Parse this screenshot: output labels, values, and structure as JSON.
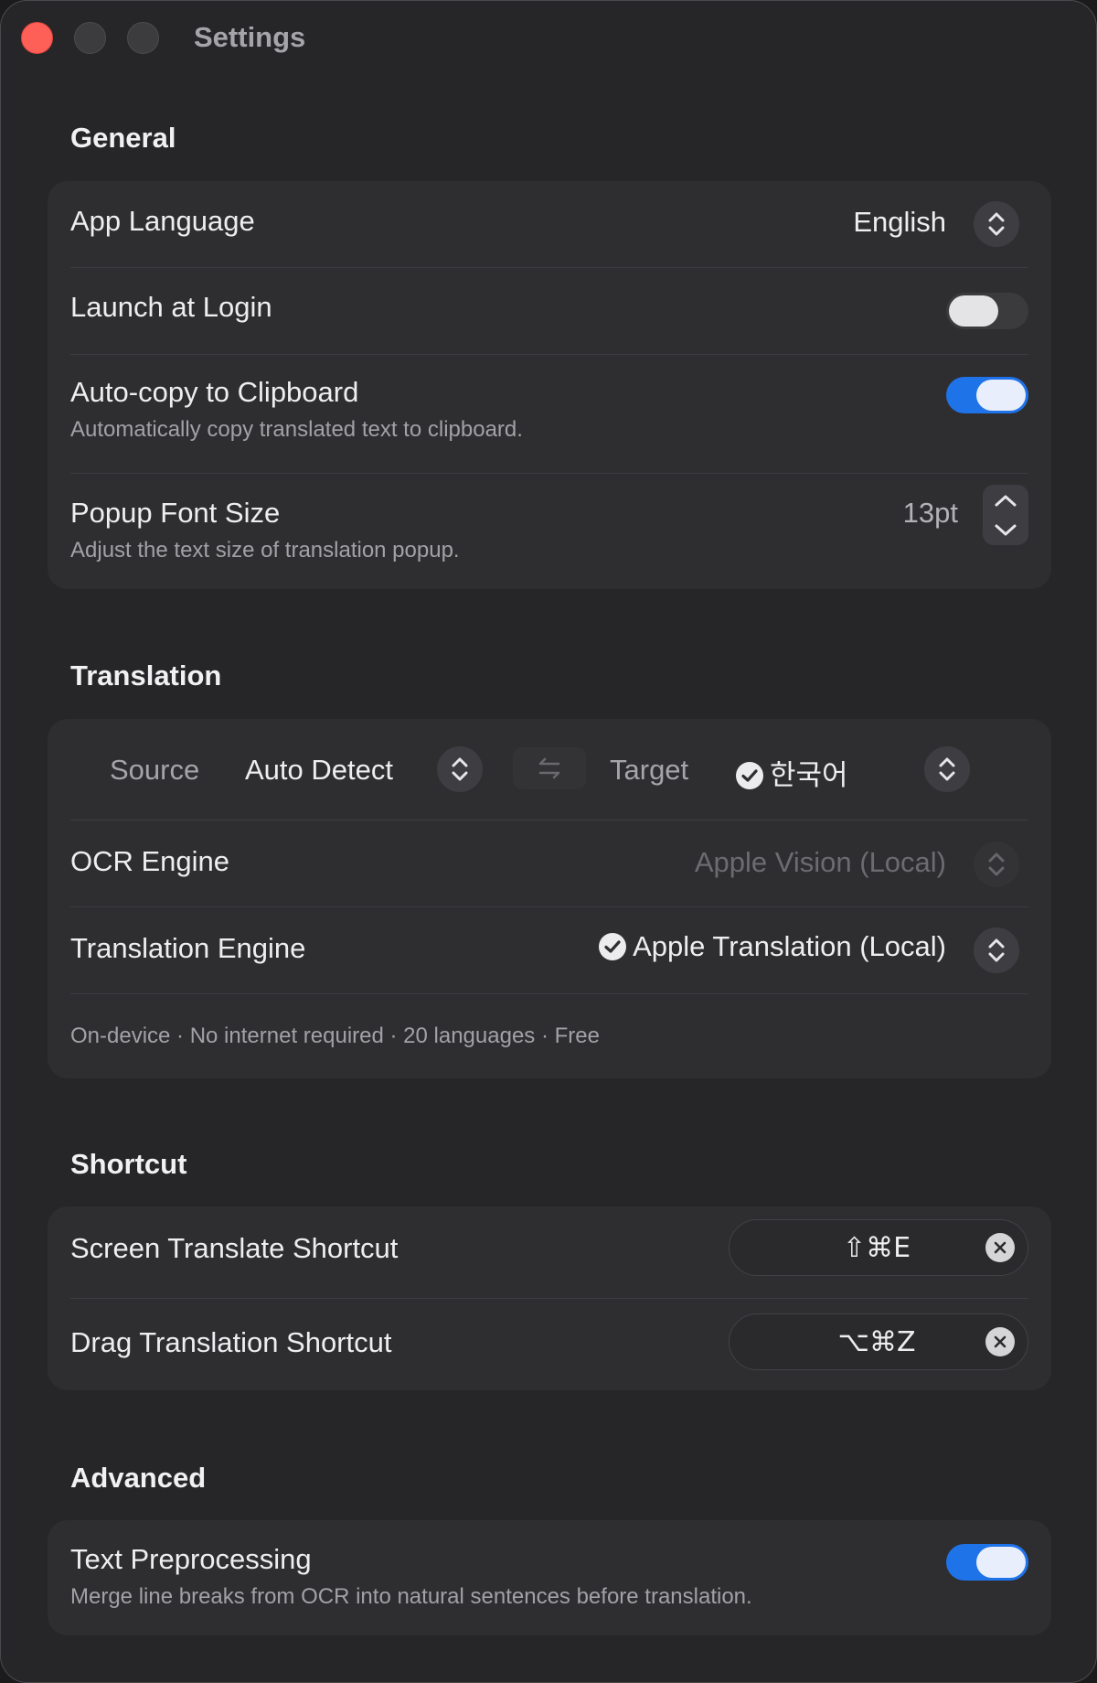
{
  "window": {
    "title": "Settings"
  },
  "general": {
    "title": "General",
    "app_language": {
      "label": "App Language",
      "value": "English"
    },
    "launch_at_login": {
      "label": "Launch at Login",
      "enabled": false
    },
    "auto_copy": {
      "label": "Auto-copy to Clipboard",
      "description": "Automatically copy translated text to clipboard.",
      "enabled": true
    },
    "popup_font_size": {
      "label": "Popup Font Size",
      "description": "Adjust the text size of translation popup.",
      "value": "13pt"
    }
  },
  "translation": {
    "title": "Translation",
    "source_label": "Source",
    "source_value": "Auto Detect",
    "target_label": "Target",
    "target_value": "한국어",
    "ocr_engine": {
      "label": "OCR Engine",
      "value": "Apple Vision (Local)"
    },
    "translation_engine": {
      "label": "Translation Engine",
      "value": "Apple Translation (Local)"
    },
    "footnote": "On-device · No internet required · 20 languages · Free"
  },
  "shortcut": {
    "title": "Shortcut",
    "screen_translate": {
      "label": "Screen Translate Shortcut",
      "keys": "⇧⌘E"
    },
    "drag_translation": {
      "label": "Drag Translation Shortcut",
      "keys": "⌥⌘Z"
    }
  },
  "advanced": {
    "title": "Advanced",
    "text_preprocessing": {
      "label": "Text Preprocessing",
      "description": "Merge line breaks from OCR into natural sentences before translation.",
      "enabled": true
    }
  },
  "colors": {
    "accent": "#1f73e8",
    "close": "#fe5f57",
    "window_bg": "#262629",
    "card_bg": "#2e2e31"
  },
  "icons": {
    "updown": "chevron-up-down-icon",
    "check": "checkmark-circle-icon",
    "swap": "swap-arrows-icon",
    "clear": "clear-x-icon"
  }
}
